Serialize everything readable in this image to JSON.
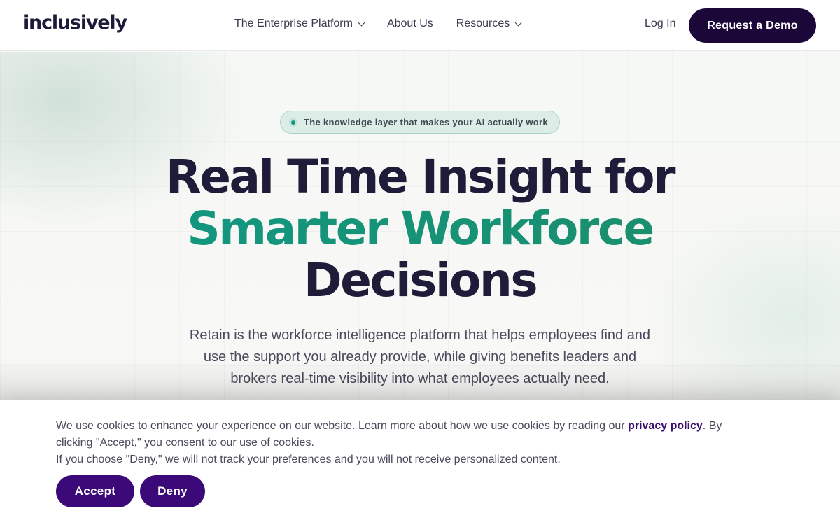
{
  "header": {
    "logo": "inclusively",
    "nav": [
      {
        "label": "The Enterprise Platform",
        "has_dropdown": true
      },
      {
        "label": "About Us",
        "has_dropdown": false
      },
      {
        "label": "Resources",
        "has_dropdown": true
      }
    ],
    "login_label": "Log In",
    "cta_label": "Request a Demo"
  },
  "hero": {
    "pill_text": "The knowledge layer that makes your AI actually work",
    "headline_line1": "Real Time Insight for",
    "headline_accent": "Smarter Workforce",
    "headline_line3": "Decisions",
    "subtext": "Retain is the workforce intelligence platform that helps employees find and use the support you already provide, while giving benefits leaders and brokers real-time visibility into what employees actually need."
  },
  "cookie_banner": {
    "text_before_link": "We use cookies to enhance your experience on our website. Learn more about how we use cookies by reading our ",
    "link_text": "privacy policy",
    "text_after_link": ". By clicking \"Accept,\" you consent to our use of cookies.",
    "text_line2": "If you choose \"Deny,\" we will not track your preferences and you will not receive personalized content.",
    "accept_label": "Accept",
    "deny_label": "Deny"
  },
  "colors": {
    "brand_dark": "#1c0838",
    "accent_teal": "#13967f",
    "cookie_button": "#3b0a78"
  },
  "icons": [
    "chevron-down-icon",
    "status-dot-icon"
  ]
}
